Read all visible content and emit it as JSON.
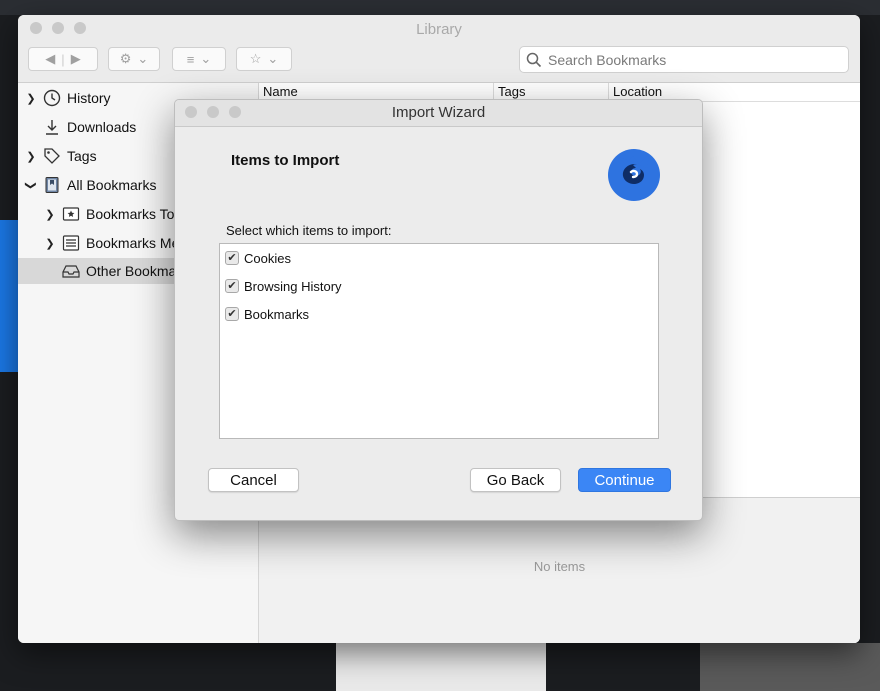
{
  "library": {
    "title": "Library",
    "search_placeholder": "Search Bookmarks",
    "sidebar": [
      {
        "label": "History",
        "icon": "clock-icon",
        "disclosure": true
      },
      {
        "label": "Downloads",
        "icon": "download-icon",
        "disclosure": false
      },
      {
        "label": "Tags",
        "icon": "tag-icon",
        "disclosure": true
      },
      {
        "label": "All Bookmarks",
        "icon": "bookmarks-book-icon",
        "disclosure": true,
        "expanded": true
      },
      {
        "label": "Bookmarks To",
        "icon": "star-folder-icon",
        "disclosure": true,
        "indent": true
      },
      {
        "label": "Bookmarks Me",
        "icon": "menu-folder-icon",
        "disclosure": true,
        "indent": true
      },
      {
        "label": "Other Bookma",
        "icon": "tray-icon",
        "disclosure": false,
        "indent": true,
        "selected": true
      }
    ],
    "columns": [
      "Name",
      "Tags",
      "Location"
    ],
    "detail_empty": "No items"
  },
  "wizard": {
    "title": "Import Wizard",
    "heading": "Items to Import",
    "prompt": "Select which items to import:",
    "items": [
      {
        "label": "Cookies",
        "checked": true
      },
      {
        "label": "Browsing History",
        "checked": true
      },
      {
        "label": "Bookmarks",
        "checked": true
      }
    ],
    "buttons": {
      "cancel": "Cancel",
      "back": "Go Back",
      "continue": "Continue"
    }
  },
  "colors": {
    "accent": "#3b86f5",
    "selected_row": "#d8d8d8"
  }
}
